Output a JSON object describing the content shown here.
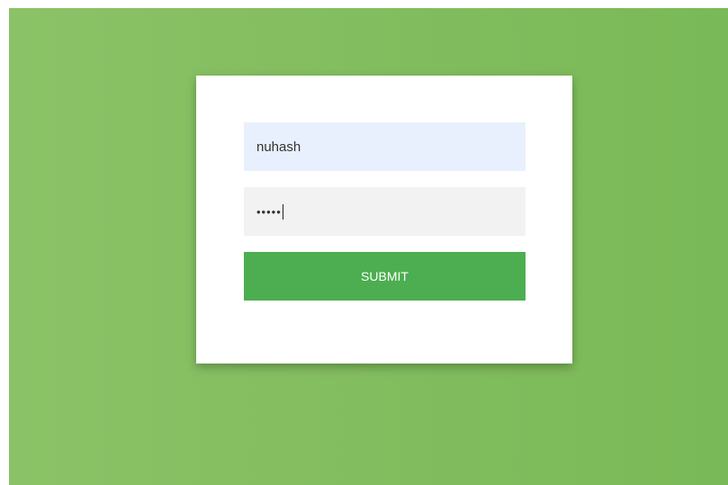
{
  "login": {
    "username_value": "nuhash",
    "password_value": "•••••",
    "submit_label": "SUBMIT"
  },
  "colors": {
    "background_green": "#82bd5f",
    "button_green": "#4cae50",
    "username_field_bg": "#e8f0fe",
    "password_field_bg": "#f2f2f2"
  }
}
